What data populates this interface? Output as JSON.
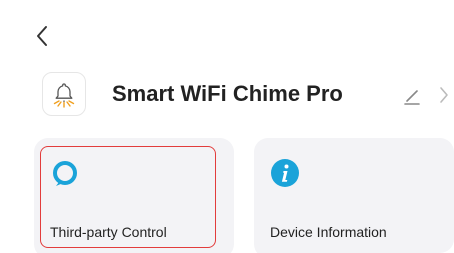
{
  "header": {
    "back_icon": "chevron-left-icon"
  },
  "device": {
    "icon": "bell-chime-icon",
    "name": "Smart WiFi Chime Pro",
    "edit_icon": "pencil-icon",
    "more_icon": "chevron-right-icon"
  },
  "cards": [
    {
      "label": "Third-party Control",
      "icon": "alexa-ring-icon",
      "color": "#1aa3d9",
      "selected": true
    },
    {
      "label": "Device Information",
      "icon": "info-icon",
      "color": "#1aa3d9",
      "selected": false
    }
  ],
  "colors": {
    "accent": "#1aa3d9",
    "highlight": "#e23c3c",
    "card_bg": "#f3f3f6"
  }
}
